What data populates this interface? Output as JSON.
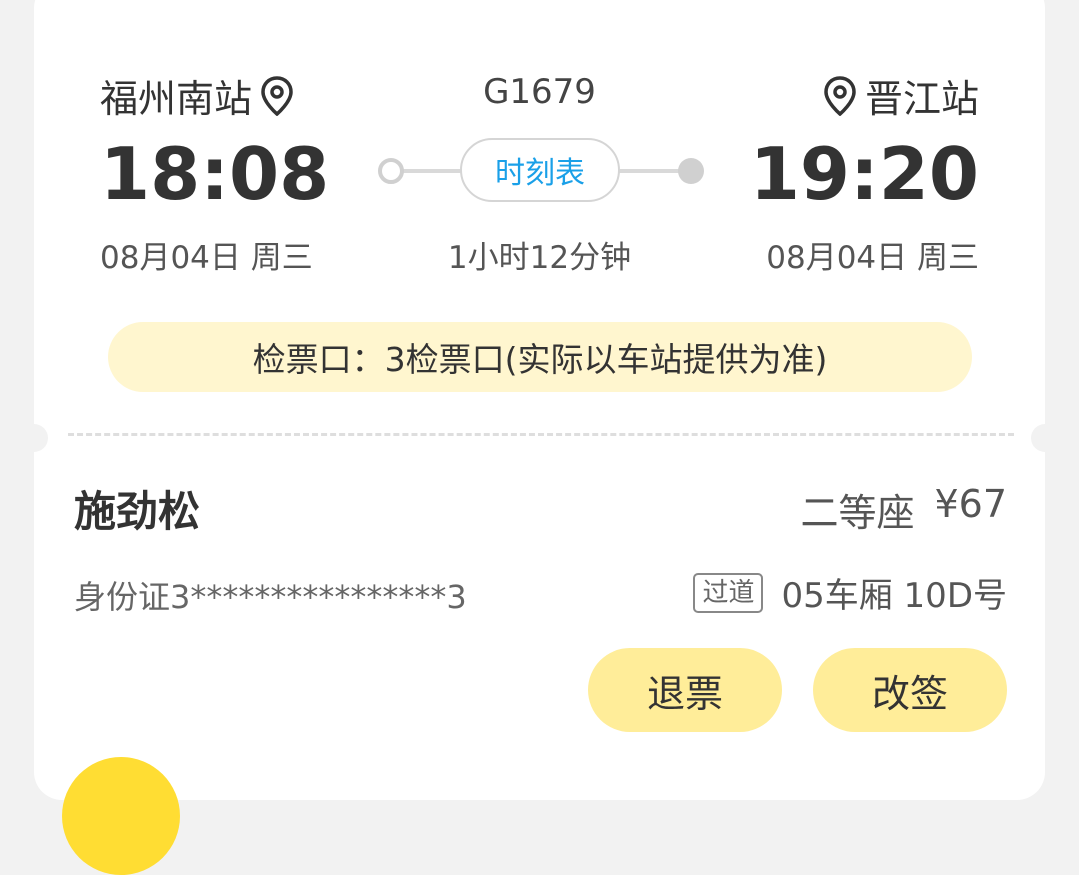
{
  "trip": {
    "from_station": "福州南站",
    "to_station": "晋江站",
    "train_no": "G1679",
    "depart_time": "18:08",
    "arrive_time": "19:20",
    "depart_date": "08月04日 周三",
    "arrive_date": "08月04日 周三",
    "duration": "1小时12分钟",
    "schedule_label": "时刻表",
    "gate_text": "检票口：3检票口(实际以车站提供为准)"
  },
  "passenger": {
    "name": "施劲松",
    "seat_class": "二等座",
    "price": "¥67",
    "id_number": "身份证3****************3",
    "seat_tag": "过道",
    "seat_no": "05车厢 10D号"
  },
  "actions": {
    "refund_label": "退票",
    "change_label": "改签"
  },
  "colors": {
    "accent_blue": "#1aa0e8",
    "button_yellow": "#ffed99",
    "gate_bg": "#fff6cf"
  },
  "icons": {
    "location": "location-pin-icon"
  }
}
